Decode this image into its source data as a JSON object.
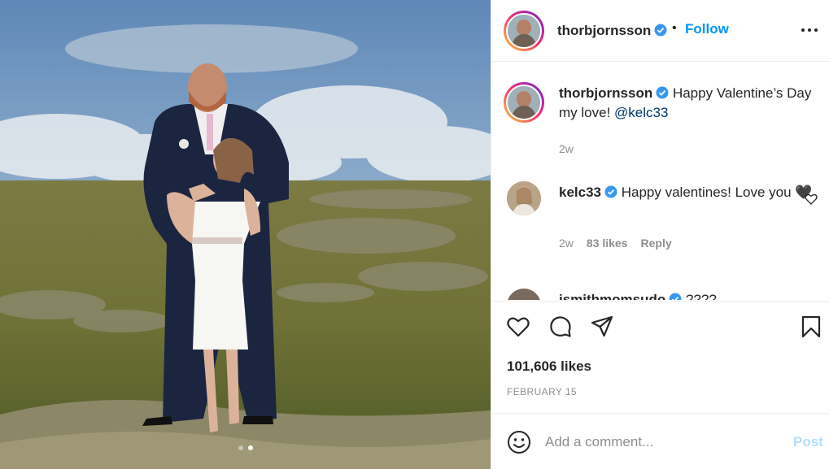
{
  "post": {
    "author": "thorbjornsson",
    "follow_label": "Follow",
    "separator": "•",
    "caption": "Happy Valentine’s Day my love!",
    "caption_mention": "@kelc33",
    "caption_time": "2w",
    "likes": "101,606 likes",
    "date": "FEBRUARY 15",
    "carousel": {
      "count": 2,
      "active": 2
    }
  },
  "comments": [
    {
      "username": "kelc33",
      "text": "Happy valentines! Love you 🖤",
      "time": "2w",
      "likes": "83 likes",
      "reply_label": "Reply"
    },
    {
      "username": "jsmithmomsudo",
      "text": "????"
    }
  ],
  "add_comment": {
    "placeholder": "Add a comment...",
    "post_label": "Post"
  },
  "colors": {
    "accent": "#0095f6",
    "post_disabled": "#b2dffc",
    "verified": "#3897f0"
  },
  "icons": [
    "verified-badge-icon",
    "more-options-icon",
    "heart-icon",
    "comment-icon",
    "share-icon",
    "bookmark-icon",
    "emoji-icon"
  ]
}
